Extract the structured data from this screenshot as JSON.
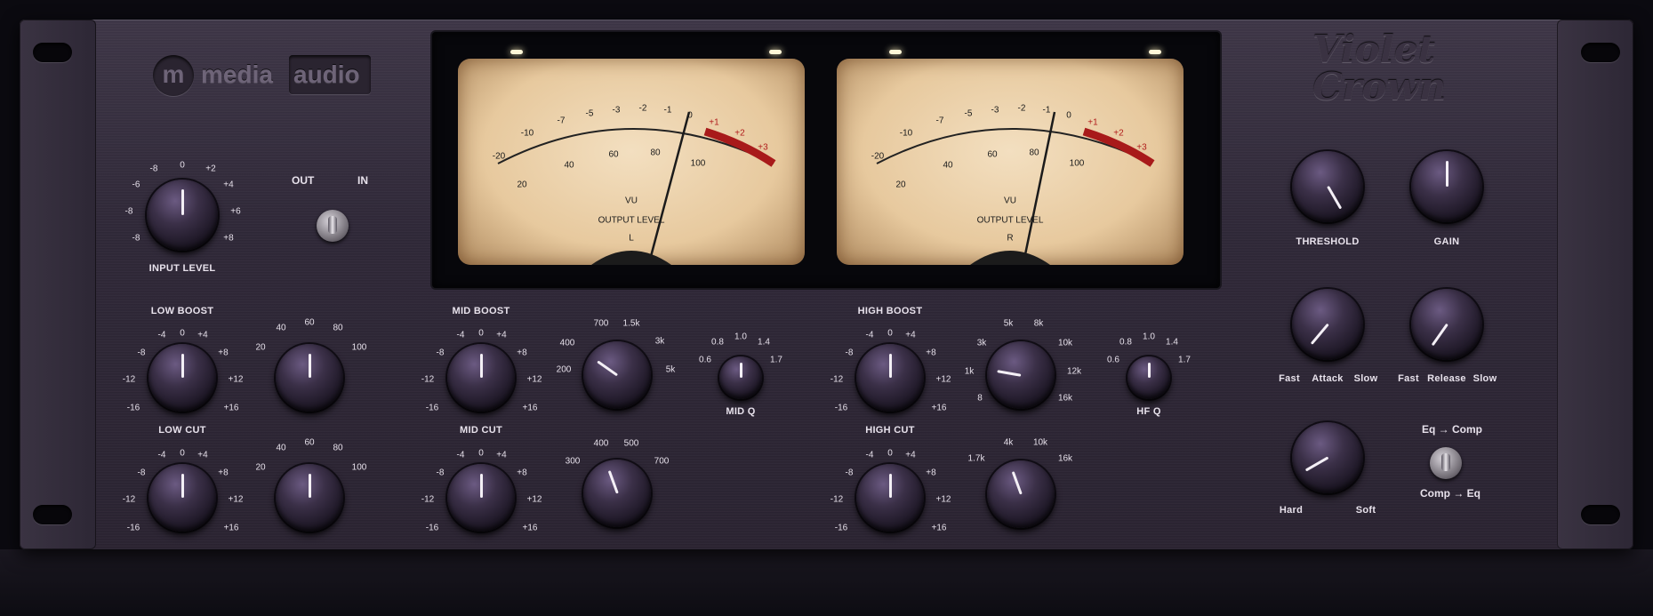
{
  "brand": {
    "mark": "m",
    "name_left": "media",
    "name_right": "audio"
  },
  "product": {
    "line1": "Violet",
    "line2": "Crown"
  },
  "meters": {
    "scale_top": [
      "-20",
      "-10",
      "-7",
      "-5",
      "-3",
      "-2",
      "-1",
      "0",
      "+1",
      "+2",
      "+3"
    ],
    "scale_bottom": [
      "20",
      "40",
      "60",
      "80",
      "100"
    ],
    "title": "VU",
    "subtitle": "OUTPUT LEVEL",
    "left_channel": "L",
    "right_channel": "R"
  },
  "input": {
    "label": "INPUT LEVEL",
    "scale": [
      "-8",
      "0",
      "+2",
      "-6",
      "+4",
      "-8",
      "+6",
      "-8",
      "+8"
    ],
    "bypass_out": "OUT",
    "bypass_in": "IN"
  },
  "eq": {
    "low_boost": {
      "label": "LOW BOOST",
      "gain_scale": [
        "-4",
        "0",
        "+4",
        "-8",
        "+8",
        "-12",
        "+12",
        "-16",
        "+16"
      ],
      "freq_scale": [
        "20",
        "40",
        "60",
        "80",
        "100"
      ]
    },
    "low_cut": {
      "label": "LOW CUT",
      "gain_scale": [
        "-4",
        "0",
        "+4",
        "-8",
        "+8",
        "-12",
        "+12",
        "-16",
        "+16"
      ],
      "freq_scale": [
        "20",
        "40",
        "60",
        "80",
        "100"
      ]
    },
    "mid_boost": {
      "label": "MID BOOST",
      "gain_scale": [
        "-4",
        "0",
        "+4",
        "-8",
        "+8",
        "-12",
        "+12",
        "-16",
        "+16"
      ],
      "freq_scale": [
        "200",
        "400",
        "700",
        "1.5k",
        "3k",
        "5k"
      ]
    },
    "mid_cut": {
      "label": "MID CUT",
      "gain_scale": [
        "-4",
        "0",
        "+4",
        "-8",
        "+8",
        "-12",
        "+12",
        "-16",
        "+16"
      ],
      "freq_scale": [
        "300",
        "400",
        "500",
        "700"
      ]
    },
    "mid_q": {
      "label": "MID Q",
      "scale": [
        "0.6",
        "0.8",
        "1.0",
        "1.4",
        "1.7"
      ]
    },
    "high_boost": {
      "label": "HIGH BOOST",
      "gain_scale": [
        "-4",
        "0",
        "+4",
        "-8",
        "+8",
        "-12",
        "+12",
        "-16",
        "+16"
      ],
      "freq_scale": [
        "1k",
        "3k",
        "5k",
        "8k",
        "10k",
        "12k",
        "16k",
        "8"
      ]
    },
    "high_cut": {
      "label": "HIGH CUT",
      "gain_scale": [
        "-4",
        "0",
        "+4",
        "-8",
        "+8",
        "-12",
        "+12",
        "-16",
        "+16"
      ],
      "freq_scale": [
        "1.7k",
        "4k",
        "10k",
        "16k"
      ]
    },
    "hf_q": {
      "label": "HF Q",
      "scale": [
        "0.6",
        "0.8",
        "1.0",
        "1.4",
        "1.7"
      ]
    }
  },
  "comp": {
    "threshold": "THRESHOLD",
    "gain": "GAIN",
    "attack": {
      "label": "Attack",
      "min": "Fast",
      "max": "Slow"
    },
    "release": {
      "label": "Release",
      "min": "Fast",
      "max": "Slow"
    },
    "knee": {
      "min": "Hard",
      "max": "Soft"
    },
    "routing": {
      "top": "Eq → Comp",
      "bottom": "Comp → Eq"
    }
  },
  "colors": {
    "panel": "#2f2838",
    "meter_face": "#ecd3ab",
    "red_zone": "#b01c1c",
    "knob": "#3b3048"
  }
}
